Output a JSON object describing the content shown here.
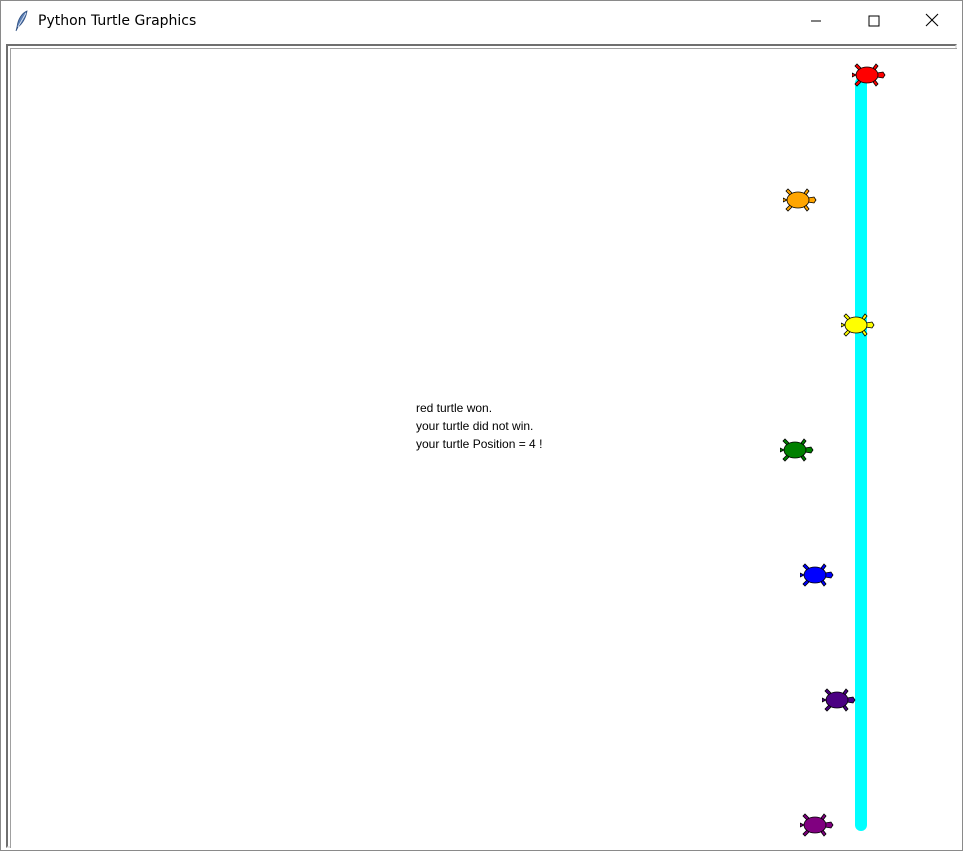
{
  "window": {
    "title": "Python Turtle Graphics",
    "icon": "feather-icon",
    "controls": {
      "minimize_icon": "minimize-icon",
      "maximize_icon": "maximize-icon",
      "close_icon": "close-icon"
    }
  },
  "canvas": {
    "background": "#ffffff",
    "finish_line_color": "#00ffff",
    "messages": [
      "red turtle won.",
      "your turtle did not win.",
      "your turtle Position = 4 !"
    ],
    "turtles": [
      {
        "color": "red",
        "fill": "#ff0000"
      },
      {
        "color": "orange",
        "fill": "#ffa500"
      },
      {
        "color": "yellow",
        "fill": "#ffff00"
      },
      {
        "color": "green",
        "fill": "#008000"
      },
      {
        "color": "blue",
        "fill": "#0000ff"
      },
      {
        "color": "indigo",
        "fill": "#4b0082"
      },
      {
        "color": "purple",
        "fill": "#800080"
      }
    ]
  }
}
